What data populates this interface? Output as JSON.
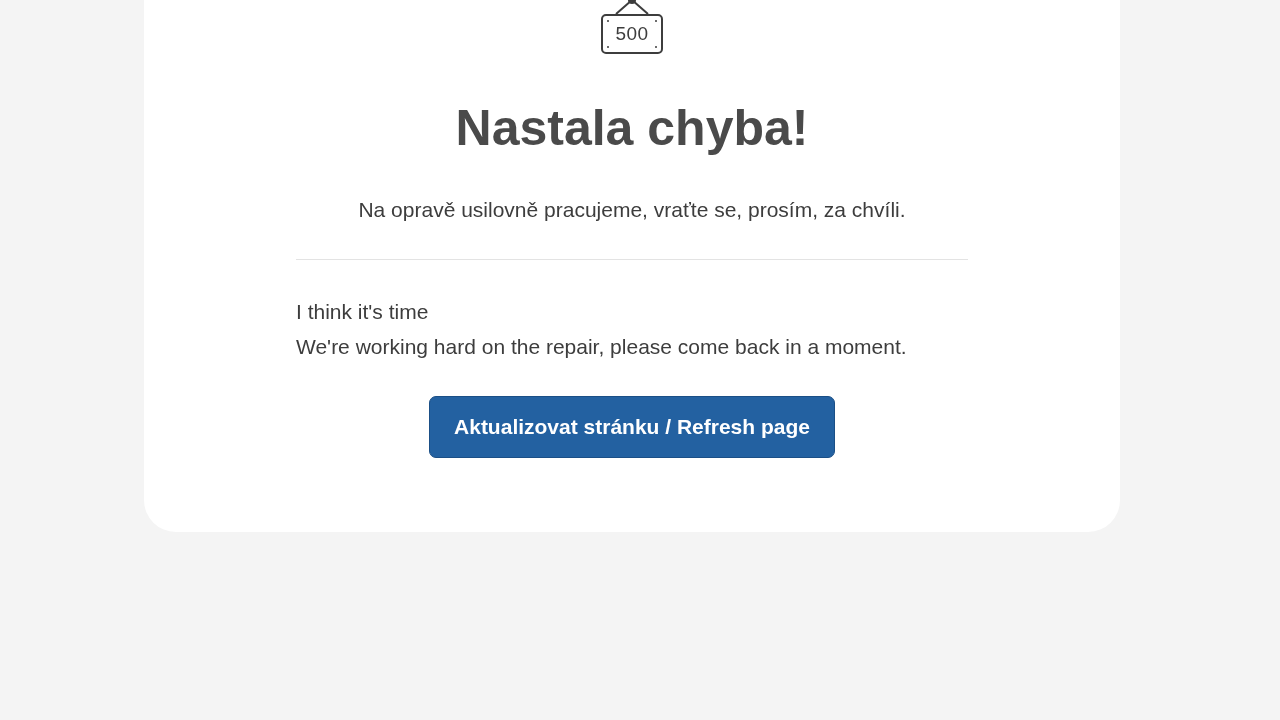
{
  "error_card": {
    "code": "500",
    "title": "Nastala chyba!",
    "subtitle": "Na opravě usilovně pracujeme, vraťte se, prosím, za chvíli.",
    "english_lines": [
      "I think it's time",
      "We're working hard on the repair, please come back in a moment."
    ],
    "button": "Aktualizovat stránku / Refresh page"
  }
}
